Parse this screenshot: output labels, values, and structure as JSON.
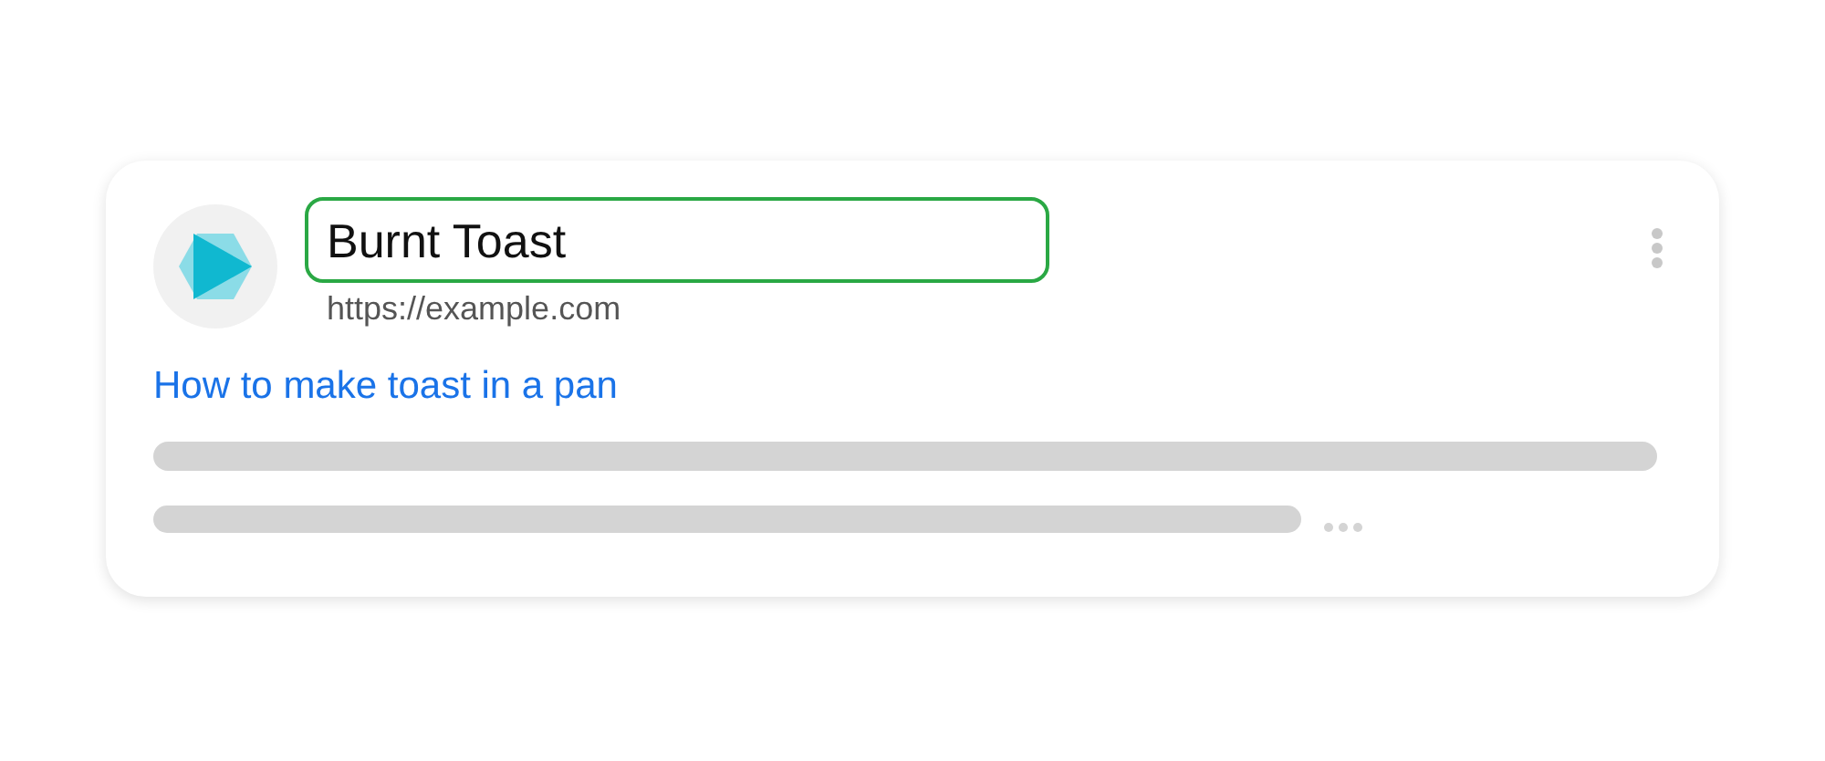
{
  "result": {
    "title": "Burnt Toast",
    "title_highlighted": true,
    "url": "https://example.com",
    "link": "How to make toast in a pan"
  }
}
